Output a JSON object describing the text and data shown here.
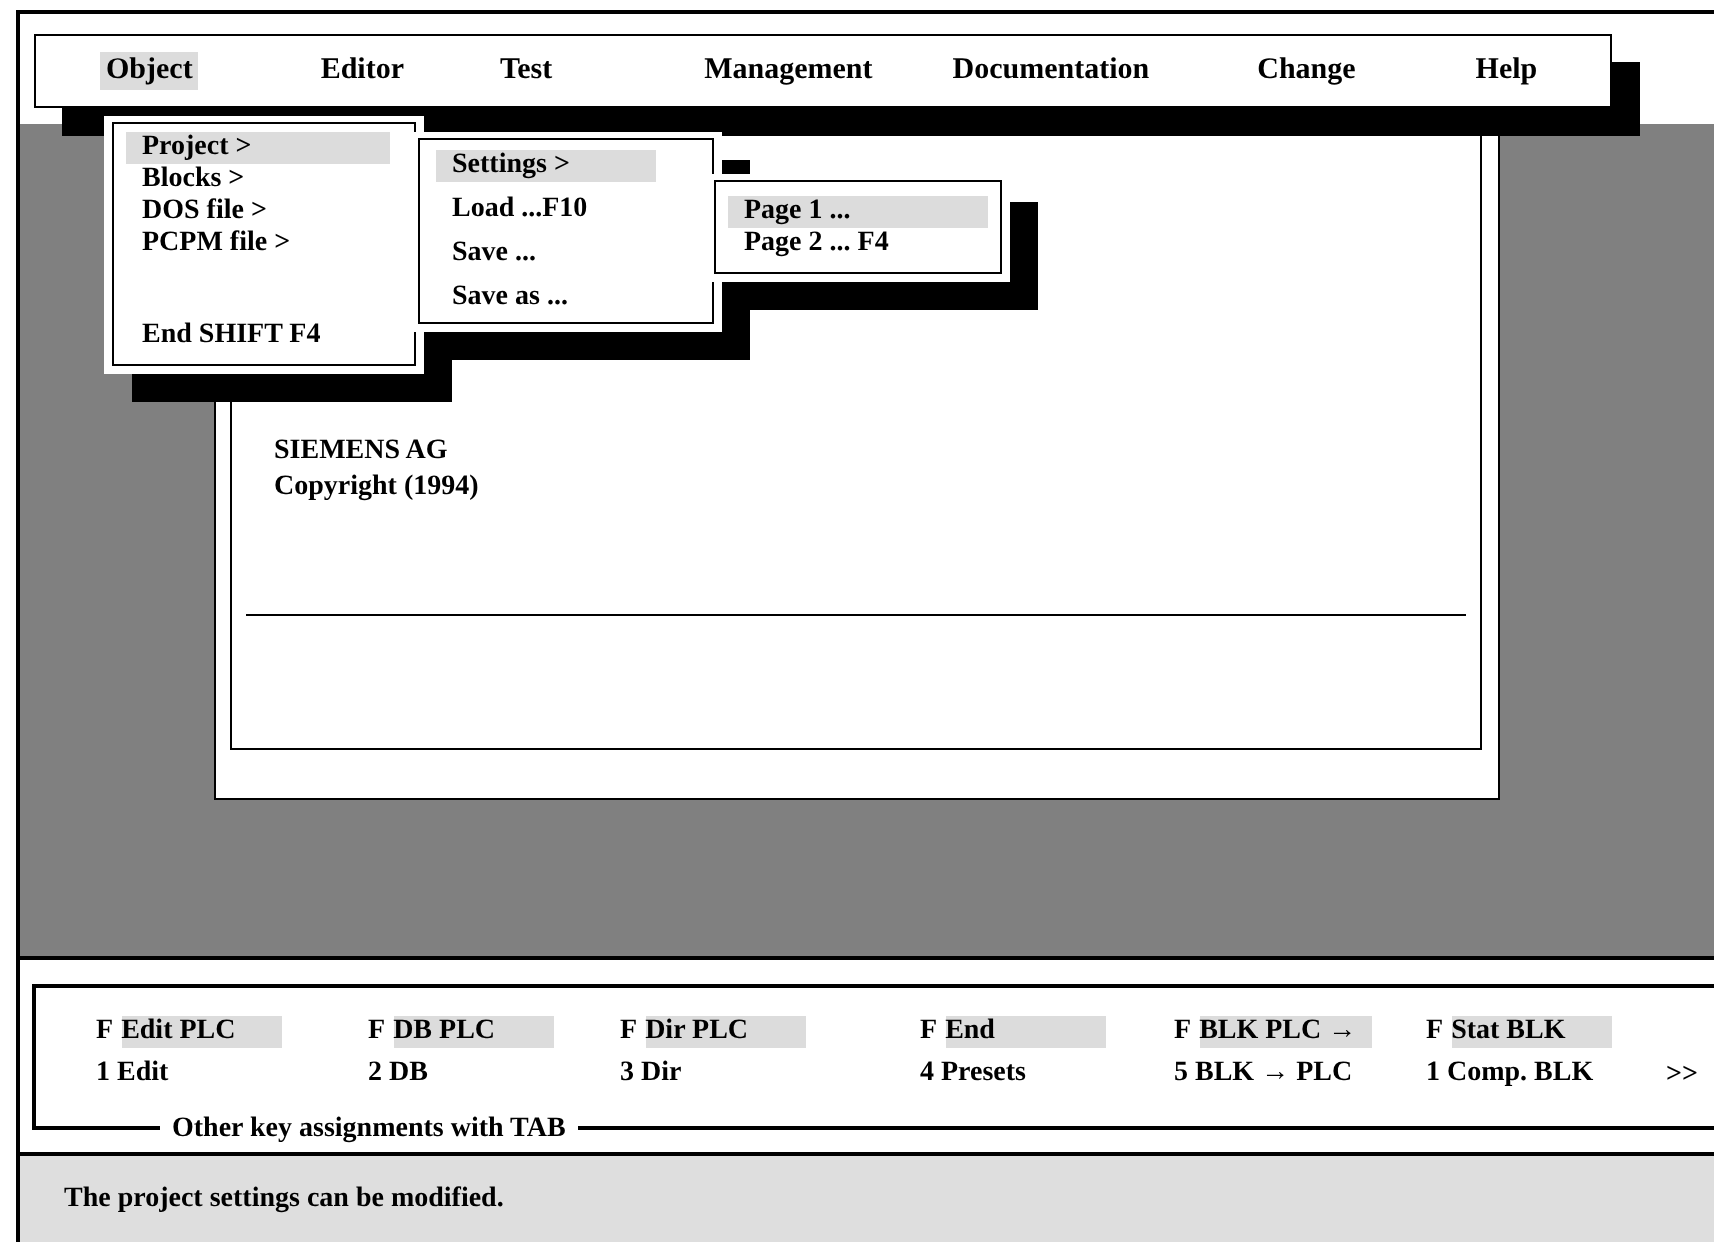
{
  "menubar": [
    {
      "label": "Object",
      "selected": true
    },
    {
      "label": "Editor",
      "selected": false
    },
    {
      "label": "Test",
      "selected": false
    },
    {
      "label": "Management",
      "selected": false
    },
    {
      "label": "Documentation",
      "selected": false
    },
    {
      "label": "Change",
      "selected": false
    },
    {
      "label": "Help",
      "selected": false
    }
  ],
  "menus": [
    {
      "items": [
        {
          "label": "Project >",
          "selected": true
        },
        {
          "label": "Blocks >",
          "selected": false
        },
        {
          "label": "DOS file >",
          "selected": false
        },
        {
          "label": "PCPM file >",
          "selected": false
        },
        {
          "label": "End  SHIFT  F4",
          "selected": false,
          "gap_before": true
        }
      ]
    },
    {
      "items": [
        {
          "label": "Settings >",
          "selected": true
        },
        {
          "label": "Load ...F10",
          "selected": false
        },
        {
          "label": "Save ...",
          "selected": false
        },
        {
          "label": "Save as ...",
          "selected": false
        }
      ]
    },
    {
      "items": [
        {
          "label": "Page 1 ...",
          "selected": true
        },
        {
          "label": "Page 2 ... F4",
          "selected": false
        }
      ]
    }
  ],
  "dialog": {
    "lines": [
      "SIEMENS AG",
      "Copyright (1994)"
    ]
  },
  "function_keys": {
    "keys": [
      {
        "prefix": "F",
        "label": "Edit PLC",
        "second": "1 Edit"
      },
      {
        "prefix": "F",
        "label": "DB PLC",
        "second": "2 DB"
      },
      {
        "prefix": "F",
        "label": "Dir PLC",
        "second": "3 Dir"
      },
      {
        "prefix": "F",
        "label": "End",
        "second": "4 Presets"
      },
      {
        "prefix": "F",
        "label": "BLK PLC →",
        "second": "5 BLK → PLC"
      },
      {
        "prefix": "F",
        "label": "Stat BLK",
        "second": "1 Comp. BLK"
      }
    ],
    "more": ">>",
    "legend": "Other key assignments with TAB"
  },
  "status_bar": "The project settings can be modified."
}
